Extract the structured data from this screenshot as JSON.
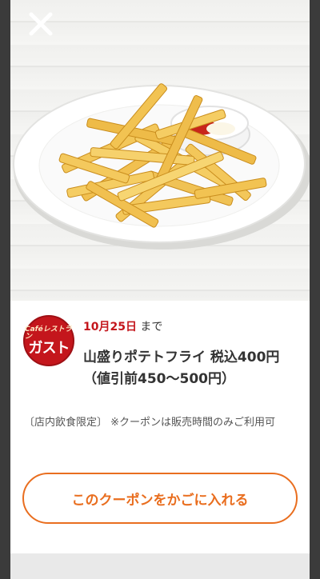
{
  "modal": {
    "close_icon": "close-icon",
    "image_alt": "山盛りポテトフライ"
  },
  "brand": {
    "logo_top": "Caféレストラン",
    "logo_main": "ガスト",
    "color": "#c4161c"
  },
  "coupon": {
    "deadline_date": "10月25日",
    "deadline_suffix": " まで",
    "product_name": "山盛りポテトフライ 税込400円（値引前450〜500円）",
    "note": "〔店内飲食限定〕 ※クーポンは販売時間のみご利用可",
    "add_to_cart_label": "このクーポンをかごに入れる",
    "accent_color": "#e96e1f"
  }
}
